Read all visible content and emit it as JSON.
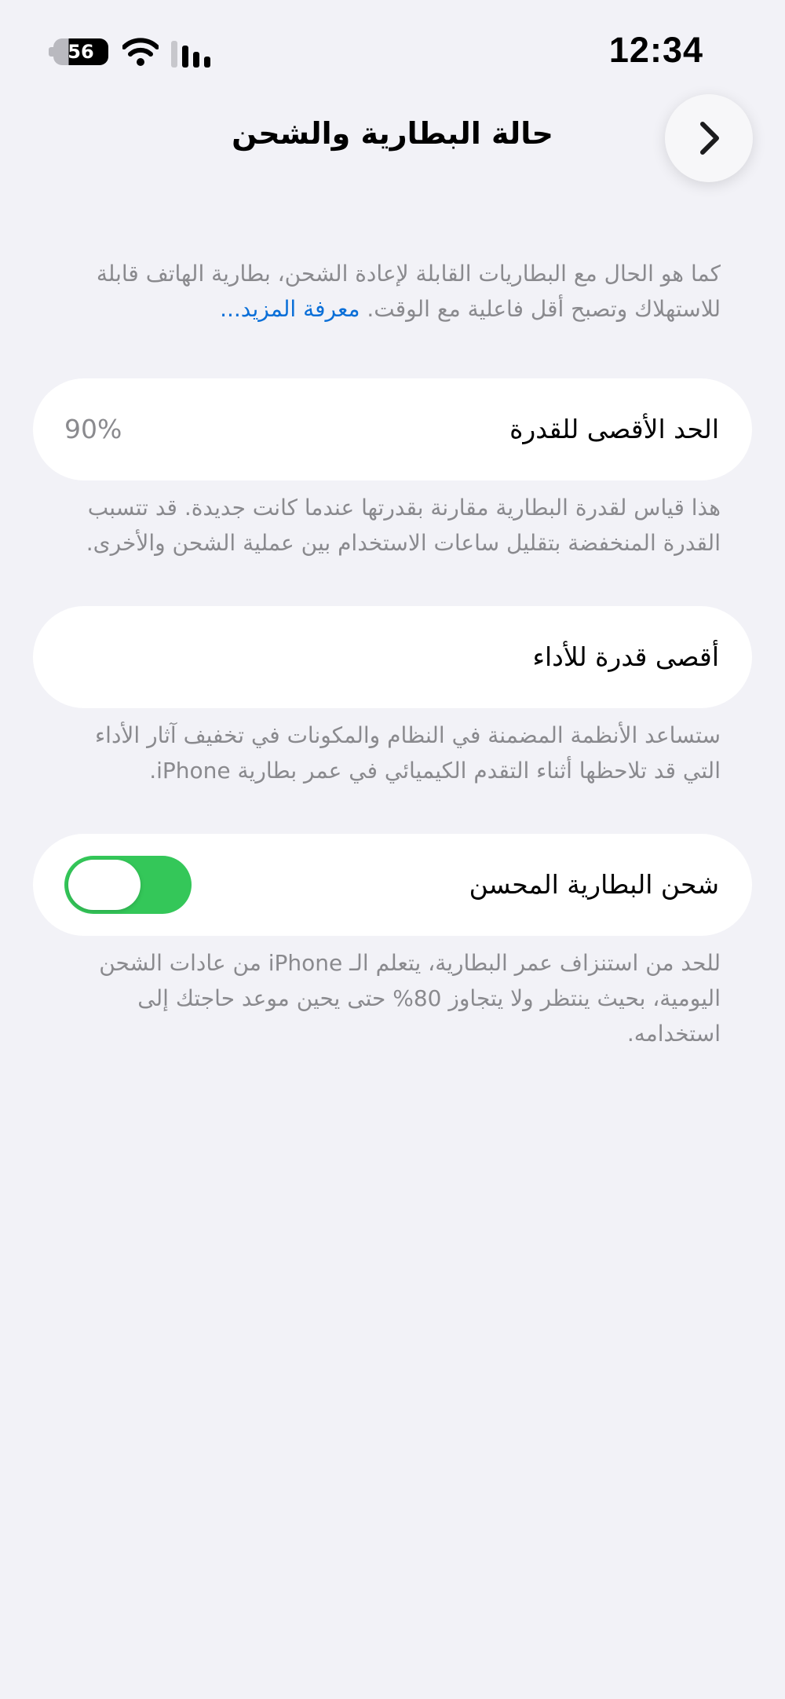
{
  "status_bar": {
    "time": "12:34",
    "battery_level": "56",
    "icons": [
      "battery-icon",
      "wifi-icon",
      "cellular-signal-icon"
    ]
  },
  "nav": {
    "title": "حالة البطارية والشحن",
    "back_icon": "chevron-right-icon"
  },
  "intro": {
    "text": "كما هو الحال مع البطاريات القابلة لإعادة الشحن، بطارية الهاتف قابلة للاستهلاك وتصبح أقل فاعلية مع الوقت.",
    "link": "معرفة المزيد..."
  },
  "maximum_capacity": {
    "label": "الحد الأقصى للقدرة",
    "value": "90%",
    "footer": "هذا قياس لقدرة البطارية مقارنة بقدرتها عندما كانت جديدة. قد تتسبب القدرة المنخفضة بتقليل ساعات الاستخدام بين عملية الشحن والأخرى."
  },
  "peak_performance": {
    "label": "أقصى قدرة للأداء",
    "footer": "ستساعد الأنظمة المضمنة في النظام والمكونات في تخفيف آثار الأداء التي قد تلاحظها أثناء التقدم الكيميائي في عمر بطارية iPhone."
  },
  "optimized_charging": {
    "label": "شحن البطارية المحسن",
    "enabled": true,
    "footer": "للحد من استنزاف عمر البطارية، يتعلم الـ iPhone من عادات الشحن اليومية، بحيث ينتظر ولا يتجاوز 80% حتى يحين موعد حاجتك إلى استخدامه."
  },
  "colors": {
    "background": "#f2f2f7",
    "toggle_on": "#34c759",
    "link": "#0a6fd8",
    "secondary_text": "#8a8a8e"
  }
}
